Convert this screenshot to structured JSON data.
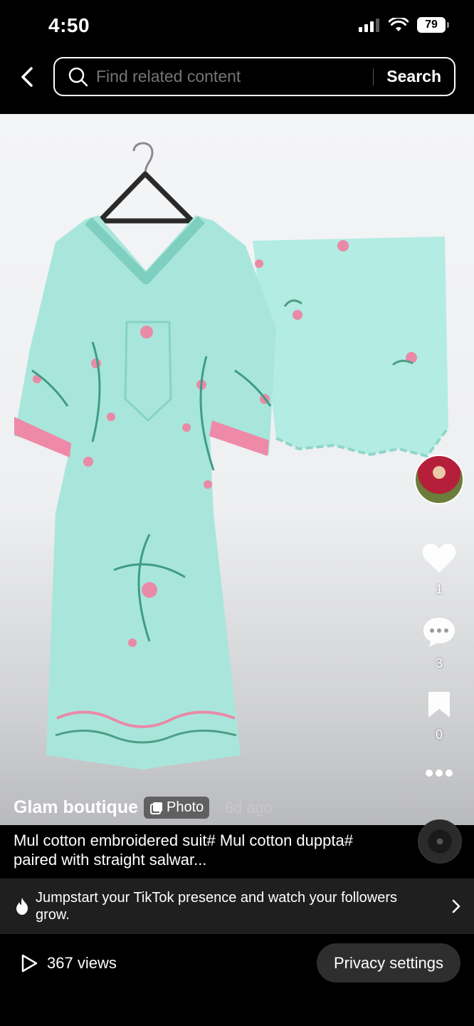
{
  "status_bar": {
    "time": "4:50",
    "battery": "79"
  },
  "search": {
    "placeholder": "Find related content",
    "button_label": "Search"
  },
  "post": {
    "author": "Glam boutique",
    "badge_label": "Photo",
    "posted": "· 6d ago",
    "caption": "Mul cotton embroidered suit# Mul cotton duppta# paired with straight salwar...",
    "likes": "1",
    "comments": "3",
    "saves": "0"
  },
  "promo": {
    "text": "Jumpstart your TikTok presence and watch your followers grow."
  },
  "footer": {
    "views": "367 views",
    "privacy_label": "Privacy settings"
  },
  "icons": {
    "back": "chevron-left-icon",
    "search": "search-icon",
    "like": "heart-icon",
    "comment": "comment-icon",
    "save": "bookmark-icon",
    "more": "more-icon",
    "play": "play-icon",
    "flame": "flame-icon",
    "chevron": "chevron-right-icon"
  },
  "colors": {
    "fabric": "#a8e6dc",
    "accent_pink": "#e98aa6",
    "background": "#000000"
  }
}
